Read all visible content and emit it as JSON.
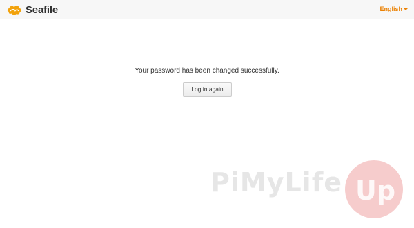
{
  "header": {
    "logo_text": "Seafile",
    "logo_icon": "seafile-cloud-icon",
    "language_label": "English",
    "language_icon": "caret-down-icon"
  },
  "main": {
    "message": "Your password has been changed successfully.",
    "login_button_label": "Log in again"
  },
  "watermark": {
    "text_left": "PiMyLife",
    "text_right": "Up"
  },
  "colors": {
    "accent": "#eb8205",
    "header_bg": "#f7f7f7",
    "watermark_red": "#e87878"
  }
}
